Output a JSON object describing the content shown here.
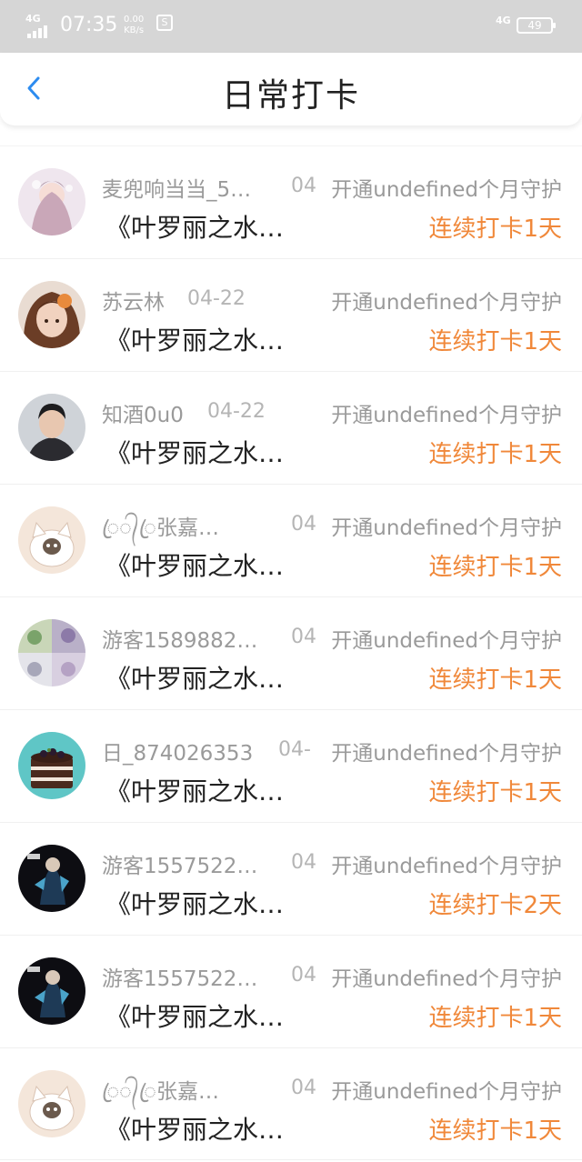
{
  "status_bar": {
    "network_left": "4G",
    "time": "07:35",
    "speed_value": "0.00",
    "speed_unit": "KB/s",
    "network_right": "4G",
    "battery": "49",
    "misc_icon": "sync-icon"
  },
  "header": {
    "title": "日常打卡",
    "back_icon": "chevron-left-icon"
  },
  "colors": {
    "accent": "#f0883a",
    "back_blue": "#2d8cf0",
    "name_gray": "#9a9a9a",
    "status_bar_bg": "#d6d6d6"
  },
  "rows": [
    {
      "name": "麦兜响当当_5…",
      "date": "04",
      "guard": "开通undefined个月守护",
      "book": "《叶罗丽之水…",
      "streak": "连续打卡1天",
      "avatar": "anime-girl-avatar"
    },
    {
      "name": "苏云林",
      "date": "04-22",
      "guard": "开通undefined个月守护",
      "book": "《叶罗丽之水…",
      "streak": "连续打卡1天",
      "avatar": "brown-hair-girl-avatar"
    },
    {
      "name": "知酒0u0",
      "date": "04-22",
      "guard": "开通undefined个月守护",
      "book": "《叶罗丽之水…",
      "streak": "连续打卡1天",
      "avatar": "man-portrait-avatar"
    },
    {
      "name": "ꦿ᭄ꦿ张嘉…",
      "date": "04",
      "guard": "开通undefined个月守护",
      "book": "《叶罗丽之水…",
      "streak": "连续打卡1天",
      "avatar": "cartoon-cat-avatar"
    },
    {
      "name": "游客1589882…",
      "date": "04",
      "guard": "开通undefined个月守护",
      "book": "《叶罗丽之水…",
      "streak": "连续打卡1天",
      "avatar": "collage-avatar"
    },
    {
      "name": "日_874026353",
      "date": "04-",
      "guard": "开通undefined个月守护",
      "book": "《叶罗丽之水…",
      "streak": "连续打卡1天",
      "avatar": "cake-avatar"
    },
    {
      "name": "游客1557522…",
      "date": "04",
      "guard": "开通undefined个月守护",
      "book": "《叶罗丽之水…",
      "streak": "连续打卡2天",
      "avatar": "dark-character-avatar"
    },
    {
      "name": "游客1557522…",
      "date": "04",
      "guard": "开通undefined个月守护",
      "book": "《叶罗丽之水…",
      "streak": "连续打卡1天",
      "avatar": "dark-character-avatar"
    },
    {
      "name": "ꦿ᭄ꦿ张嘉…",
      "date": "04",
      "guard": "开通undefined个月守护",
      "book": "《叶罗丽之水…",
      "streak": "连续打卡1天",
      "avatar": "cartoon-cat-avatar"
    }
  ]
}
